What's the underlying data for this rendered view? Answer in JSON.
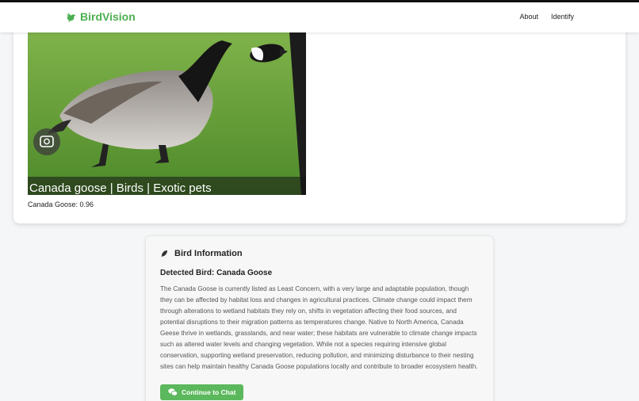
{
  "brand": {
    "name": "BirdVision",
    "color": "#4caf50"
  },
  "nav": {
    "links": [
      "About",
      "Identify"
    ]
  },
  "result": {
    "image_text": "Canada goose | Birds | Exotic pets",
    "caption": "Canada Goose: 0.96"
  },
  "info": {
    "header": "Bird Information",
    "header_icon": "feather-icon",
    "detected": "Detected Bird: Canada Goose",
    "description": "The Canada Goose is currently listed as Least Concern, with a very large and adaptable population, though they can be affected by habitat loss and changes in agricultural practices. Climate change could impact them through alterations to wetland habitats they rely on, shifts in vegetation affecting their food sources, and potential disruptions to their migration patterns as temperatures change. Native to North America, Canada Geese thrive in wetlands, grasslands, and near water; these habitats are vulnerable to climate change impacts such as altered water levels and changing vegetation. While not a species requiring intensive global conservation, supporting wetland preservation, reducing pollution, and minimizing disturbance to their nesting sites can help maintain healthy Canada Goose populations locally and contribute to broader ecosystem health.",
    "chat_button": "Continue to Chat",
    "chat_icon": "chat-bubbles-icon",
    "button_color": "#5cb85c"
  }
}
